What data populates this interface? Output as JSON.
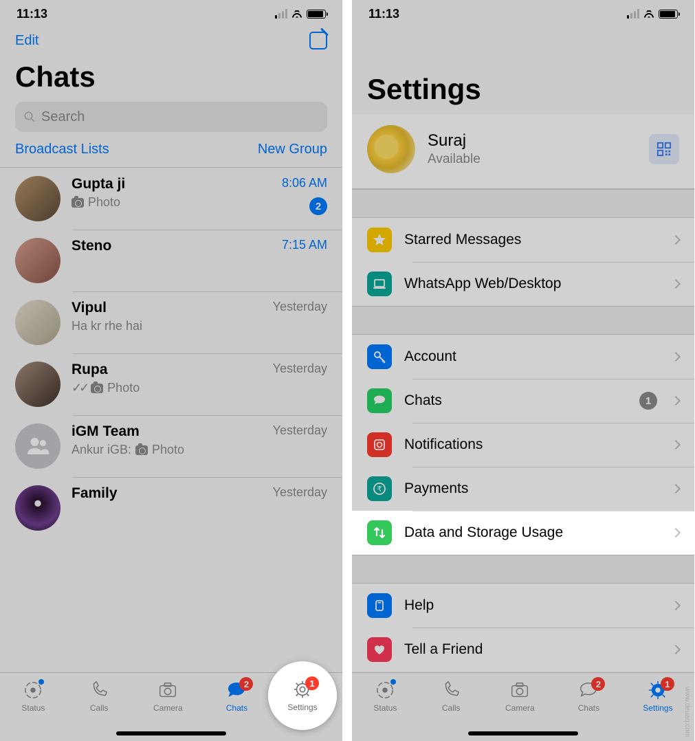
{
  "status": {
    "time": "11:13"
  },
  "left": {
    "edit": "Edit",
    "title": "Chats",
    "search_placeholder": "Search",
    "broadcast": "Broadcast Lists",
    "new_group": "New Group",
    "chats": [
      {
        "name": "Gupta ji",
        "preview": "Photo",
        "preview_icon": "camera",
        "time": "8:06 AM",
        "time_blue": true,
        "unread": "2",
        "avatar": "av-1"
      },
      {
        "name": "Steno",
        "preview": "",
        "preview_icon": "",
        "time": "7:15 AM",
        "time_blue": true,
        "avatar": "av-2"
      },
      {
        "name": "Vipul",
        "preview": "Ha kr rhe hai",
        "preview_icon": "",
        "time": "Yesterday",
        "avatar": "av-3"
      },
      {
        "name": "Rupa",
        "preview": "Photo",
        "preview_icon": "camera",
        "ticks": true,
        "time": "Yesterday",
        "avatar": "av-4"
      },
      {
        "name": "iGM Team",
        "preview_prefix": "Ankur iGB:",
        "preview": "Photo",
        "preview_icon": "camera",
        "time": "Yesterday",
        "avatar": "group"
      },
      {
        "name": "Family",
        "preview": "",
        "time": "Yesterday",
        "avatar": "av-6"
      }
    ]
  },
  "right": {
    "title": "Settings",
    "profile": {
      "name": "Suraj",
      "status": "Available"
    },
    "group1": [
      {
        "icon": "star",
        "label": "Starred Messages",
        "color": "#ffcc00"
      },
      {
        "icon": "laptop",
        "label": "WhatsApp Web/Desktop",
        "color": "#0aa99a"
      }
    ],
    "group2": [
      {
        "icon": "key",
        "label": "Account",
        "color": "#007aff"
      },
      {
        "icon": "chats",
        "label": "Chats",
        "color": "#25d366",
        "badge": "1"
      },
      {
        "icon": "notif",
        "label": "Notifications",
        "color": "#ff3b30"
      },
      {
        "icon": "pay",
        "label": "Payments",
        "color": "#0aa99a"
      },
      {
        "icon": "data",
        "label": "Data and Storage Usage",
        "color": "#34c759",
        "highlight": true
      }
    ],
    "group3": [
      {
        "icon": "help",
        "label": "Help",
        "color": "#007aff"
      },
      {
        "icon": "heart",
        "label": "Tell a Friend",
        "color": "#ff3b5c"
      }
    ]
  },
  "tabs": {
    "status": "Status",
    "calls": "Calls",
    "camera": "Camera",
    "chats": "Chats",
    "settings": "Settings",
    "chats_badge": "2",
    "settings_badge": "1"
  },
  "watermark": "www.deuaq.com"
}
